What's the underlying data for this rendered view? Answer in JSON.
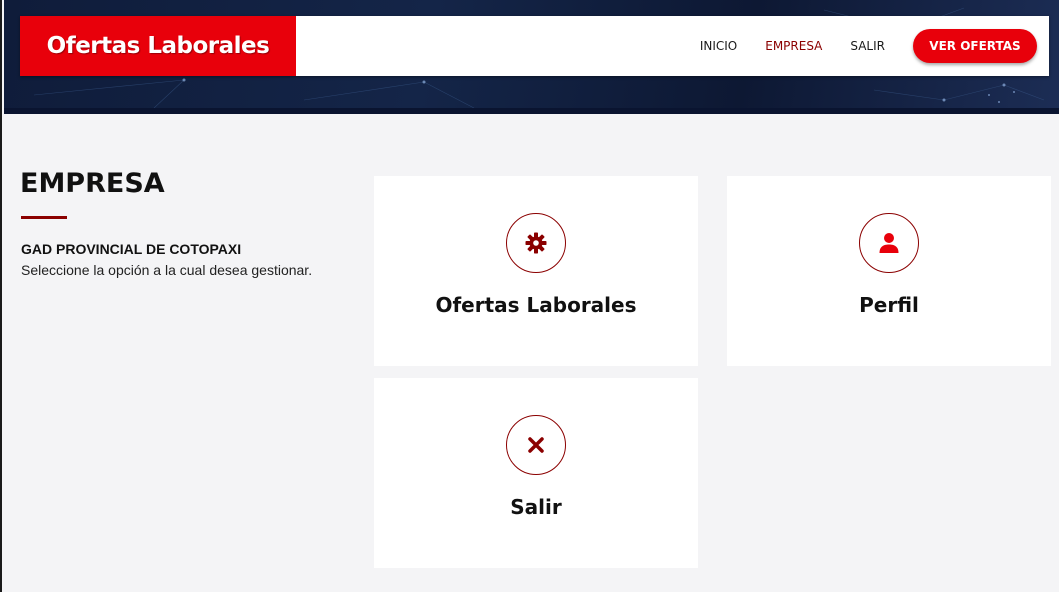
{
  "brand": {
    "title": "Ofertas Laborales"
  },
  "nav": {
    "items": [
      {
        "label": "INICIO",
        "active": false
      },
      {
        "label": "EMPRESA",
        "active": true
      },
      {
        "label": "SALIR",
        "active": false
      }
    ],
    "cta_label": "VER OFERTAS"
  },
  "page": {
    "title": "EMPRESA",
    "org_name": "GAD PROVINCIAL DE COTOPAXI",
    "description": "Seleccione la opción a la cual desea gestionar."
  },
  "cards": [
    {
      "label": "Ofertas Laborales",
      "icon": "gear-icon"
    },
    {
      "label": "Perfil",
      "icon": "user-icon"
    },
    {
      "label": "Salir",
      "icon": "close-icon"
    }
  ],
  "colors": {
    "brand_red": "#e8000b",
    "accent_dark_red": "#8b0000",
    "hero_navy": "#142548",
    "page_bg": "#f4f4f6"
  }
}
